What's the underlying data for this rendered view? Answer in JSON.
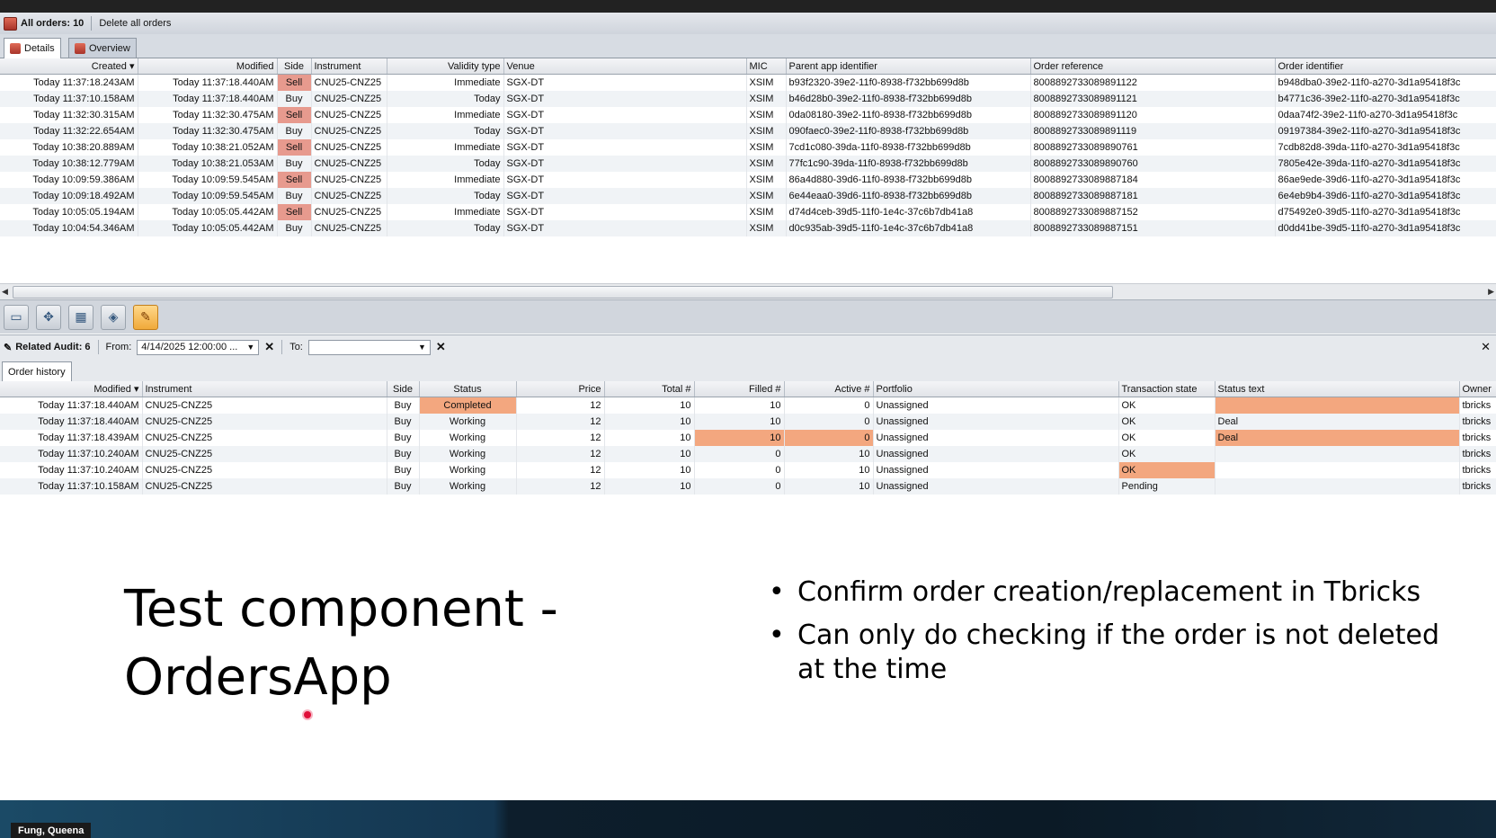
{
  "orders_bar": {
    "title": "All orders: 10",
    "delete_all": "Delete all orders"
  },
  "orders_tabs": [
    "Details",
    "Overview"
  ],
  "orders_columns": [
    "Created",
    "Modified",
    "Side",
    "Instrument",
    "Validity type",
    "Venue",
    "MIC",
    "Parent app identifier",
    "Order reference",
    "Order identifier"
  ],
  "orders_rows": [
    {
      "created": "Today 11:37:18.243AM",
      "modified": "Today 11:37:18.440AM",
      "side": "Sell",
      "instrument": "CNU25-CNZ25",
      "validity": "Immediate",
      "venue": "SGX-DT",
      "mic": "XSIM",
      "parent": "b93f2320-39e2-11f0-8938-f732bb699d8b",
      "ref": "8008892733089891122",
      "order_id": "b948dba0-39e2-11f0-a270-3d1a95418f3c"
    },
    {
      "created": "Today 11:37:10.158AM",
      "modified": "Today 11:37:18.440AM",
      "side": "Buy",
      "instrument": "CNU25-CNZ25",
      "validity": "Today",
      "venue": "SGX-DT",
      "mic": "XSIM",
      "parent": "b46d28b0-39e2-11f0-8938-f732bb699d8b",
      "ref": "8008892733089891121",
      "order_id": "b4771c36-39e2-11f0-a270-3d1a95418f3c"
    },
    {
      "created": "Today 11:32:30.315AM",
      "modified": "Today 11:32:30.475AM",
      "side": "Sell",
      "instrument": "CNU25-CNZ25",
      "validity": "Immediate",
      "venue": "SGX-DT",
      "mic": "XSIM",
      "parent": "0da08180-39e2-11f0-8938-f732bb699d8b",
      "ref": "8008892733089891120",
      "order_id": "0daa74f2-39e2-11f0-a270-3d1a95418f3c"
    },
    {
      "created": "Today 11:32:22.654AM",
      "modified": "Today 11:32:30.475AM",
      "side": "Buy",
      "instrument": "CNU25-CNZ25",
      "validity": "Today",
      "venue": "SGX-DT",
      "mic": "XSIM",
      "parent": "090faec0-39e2-11f0-8938-f732bb699d8b",
      "ref": "8008892733089891119",
      "order_id": "09197384-39e2-11f0-a270-3d1a95418f3c"
    },
    {
      "created": "Today 10:38:20.889AM",
      "modified": "Today 10:38:21.052AM",
      "side": "Sell",
      "instrument": "CNU25-CNZ25",
      "validity": "Immediate",
      "venue": "SGX-DT",
      "mic": "XSIM",
      "parent": "7cd1c080-39da-11f0-8938-f732bb699d8b",
      "ref": "8008892733089890761",
      "order_id": "7cdb82d8-39da-11f0-a270-3d1a95418f3c"
    },
    {
      "created": "Today 10:38:12.779AM",
      "modified": "Today 10:38:21.053AM",
      "side": "Buy",
      "instrument": "CNU25-CNZ25",
      "validity": "Today",
      "venue": "SGX-DT",
      "mic": "XSIM",
      "parent": "77fc1c90-39da-11f0-8938-f732bb699d8b",
      "ref": "8008892733089890760",
      "order_id": "7805e42e-39da-11f0-a270-3d1a95418f3c"
    },
    {
      "created": "Today 10:09:59.386AM",
      "modified": "Today 10:09:59.545AM",
      "side": "Sell",
      "instrument": "CNU25-CNZ25",
      "validity": "Immediate",
      "venue": "SGX-DT",
      "mic": "XSIM",
      "parent": "86a4d880-39d6-11f0-8938-f732bb699d8b",
      "ref": "8008892733089887184",
      "order_id": "86ae9ede-39d6-11f0-a270-3d1a95418f3c"
    },
    {
      "created": "Today 10:09:18.492AM",
      "modified": "Today 10:09:59.545AM",
      "side": "Buy",
      "instrument": "CNU25-CNZ25",
      "validity": "Today",
      "venue": "SGX-DT",
      "mic": "XSIM",
      "parent": "6e44eaa0-39d6-11f0-8938-f732bb699d8b",
      "ref": "8008892733089887181",
      "order_id": "6e4eb9b4-39d6-11f0-a270-3d1a95418f3c"
    },
    {
      "created": "Today 10:05:05.194AM",
      "modified": "Today 10:05:05.442AM",
      "side": "Sell",
      "instrument": "CNU25-CNZ25",
      "validity": "Immediate",
      "venue": "SGX-DT",
      "mic": "XSIM",
      "parent": "d74d4ceb-39d5-11f0-1e4c-37c6b7db41a8",
      "ref": "8008892733089887152",
      "order_id": "d75492e0-39d5-11f0-a270-3d1a95418f3c"
    },
    {
      "created": "Today 10:04:54.346AM",
      "modified": "Today 10:05:05.442AM",
      "side": "Buy",
      "instrument": "CNU25-CNZ25",
      "validity": "Today",
      "venue": "SGX-DT",
      "mic": "XSIM",
      "parent": "d0c935ab-39d5-11f0-1e4c-37c6b7db41a8",
      "ref": "8008892733089887151",
      "order_id": "d0dd41be-39d5-11f0-a270-3d1a95418f3c"
    }
  ],
  "toolbar_icons": [
    "panel-icon",
    "move-icon",
    "calculator-icon",
    "cube-icon",
    "audit-icon"
  ],
  "audit_bar": {
    "title": "Related Audit: 6",
    "from_label": "From:",
    "from_value": "4/14/2025 12:00:00 ...",
    "to_label": "To:",
    "to_value": ""
  },
  "audit_tab": "Order history",
  "audit_columns": [
    "Modified",
    "Instrument",
    "Side",
    "Status",
    "Price",
    "Total #",
    "Filled #",
    "Active #",
    "Portfolio",
    "Transaction state",
    "Status text",
    "Owner"
  ],
  "audit_rows": [
    {
      "modified": "Today 11:37:18.440AM",
      "instrument": "CNU25-CNZ25",
      "side": "Buy",
      "status": "Completed",
      "price": "12",
      "total": "10",
      "filled": "10",
      "active": "0",
      "portfolio": "Unassigned",
      "tx_state": "OK",
      "status_text": "",
      "owner": "tbricks"
    },
    {
      "modified": "Today 11:37:18.440AM",
      "instrument": "CNU25-CNZ25",
      "side": "Buy",
      "status": "Working",
      "price": "12",
      "total": "10",
      "filled": "10",
      "active": "0",
      "portfolio": "Unassigned",
      "tx_state": "OK",
      "status_text": "Deal",
      "owner": "tbricks"
    },
    {
      "modified": "Today 11:37:18.439AM",
      "instrument": "CNU25-CNZ25",
      "side": "Buy",
      "status": "Working",
      "price": "12",
      "total": "10",
      "filled": "10",
      "active": "0",
      "portfolio": "Unassigned",
      "tx_state": "OK",
      "status_text": "Deal",
      "owner": "tbricks"
    },
    {
      "modified": "Today 11:37:10.240AM",
      "instrument": "CNU25-CNZ25",
      "side": "Buy",
      "status": "Working",
      "price": "12",
      "total": "10",
      "filled": "0",
      "active": "10",
      "portfolio": "Unassigned",
      "tx_state": "OK",
      "status_text": "",
      "owner": "tbricks"
    },
    {
      "modified": "Today 11:37:10.240AM",
      "instrument": "CNU25-CNZ25",
      "side": "Buy",
      "status": "Working",
      "price": "12",
      "total": "10",
      "filled": "0",
      "active": "10",
      "portfolio": "Unassigned",
      "tx_state": "OK",
      "status_text": "",
      "owner": "tbricks"
    },
    {
      "modified": "Today 11:37:10.158AM",
      "instrument": "CNU25-CNZ25",
      "side": "Buy",
      "status": "Working",
      "price": "12",
      "total": "10",
      "filled": "0",
      "active": "10",
      "portfolio": "Unassigned",
      "tx_state": "Pending",
      "status_text": "",
      "owner": "tbricks"
    }
  ],
  "slide": {
    "title_line1": "Test component -",
    "title_line2": "OrdersApp",
    "bullets": [
      "Confirm order creation/replacement in Tbricks",
      "Can only do checking if the order is not deleted at the time"
    ]
  },
  "presenter_name": "Fung, Queena",
  "colors": {
    "sell": "#e79a8e",
    "buy": "#bfe0b4",
    "highlight": "#f3a77f",
    "selection": "#8fc2f2"
  }
}
